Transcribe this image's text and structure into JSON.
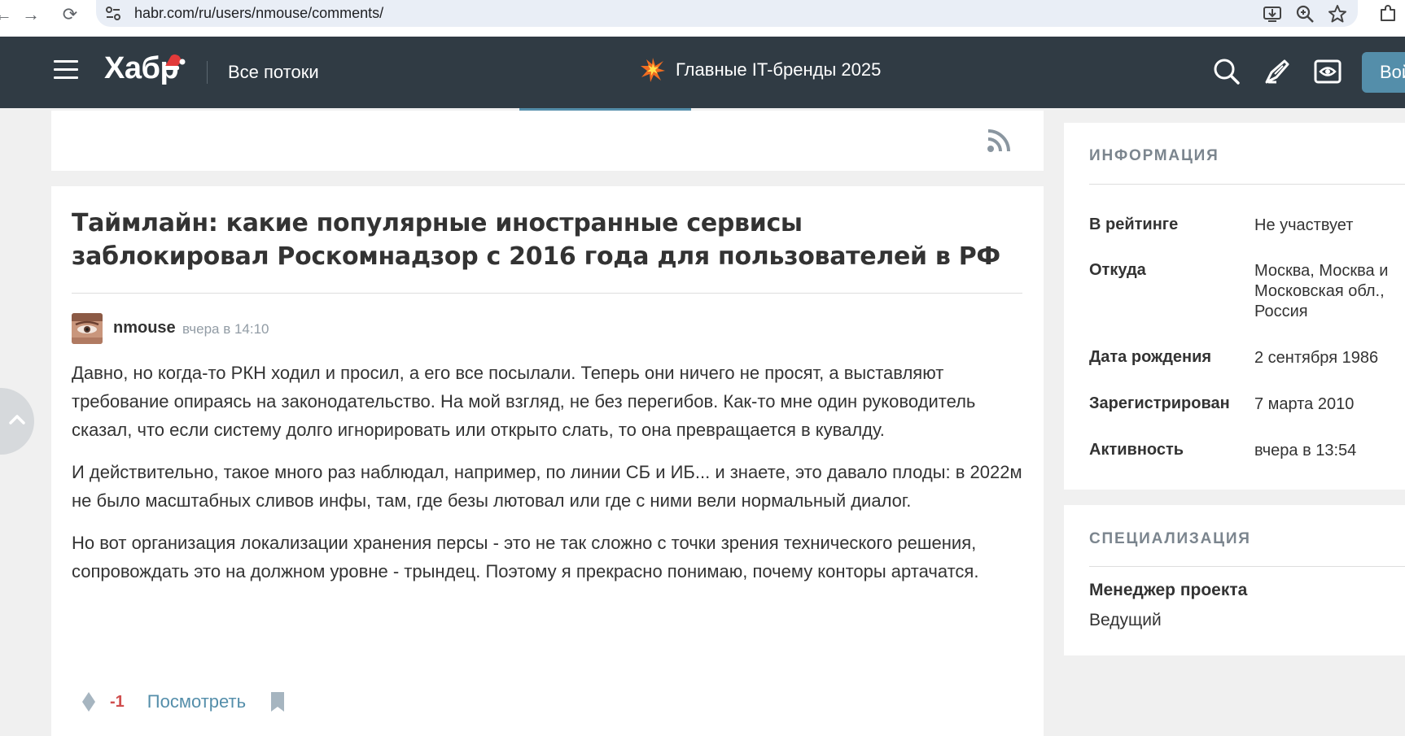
{
  "browser": {
    "back": "←",
    "forward": "→",
    "reload": "⟳",
    "url": "habr.com/ru/users/nmouse/comments/"
  },
  "header": {
    "logo": "Хабр",
    "all_flows": "Все потоки",
    "promo": "Главные IT-бренды 2025",
    "login": "Войти"
  },
  "comment": {
    "post_title": "Таймлайн: какие популярные иностранные сервисы заблокировал Роскомнадзор с 2016 года для пользователей в РФ",
    "author": "nmouse",
    "time": "вчера в 14:10",
    "paragraphs": [
      "Давно, но когда-то РКН ходил и просил, а его все посылали. Теперь они ничего не просят, а выставляют требование опираясь на законодательство. На мой взгляд, не без перегибов. Как-то мне один руководитель сказал, что если систему долго игнорировать или открыто слать, то она превращается в кувалду.",
      "И действительно, такое много раз наблюдал, например, по линии СБ и ИБ... и знаете, это давало плоды: в 2022м не было масштабных сливов инфы, там, где безы лютовал или где с ними вели нормальный диалог.",
      "Но вот организация локализации хранения персы - это не так сложно с точки зрения технического решения, сопровождать это на должном уровне - трындец. Поэтому я прекрасно понимаю, почему конторы артачатся."
    ],
    "score": "-1",
    "view_link": "Посмотреть"
  },
  "sidebar": {
    "info_heading": "ИНФОРМАЦИЯ",
    "info": [
      {
        "key": "В рейтинге",
        "value": "Не участвует"
      },
      {
        "key": "Откуда",
        "value": "Москва, Москва и Московская обл., Россия"
      },
      {
        "key": "Дата рождения",
        "value": "2 сентября 1986"
      },
      {
        "key": "Зарегистрирован",
        "value": "7 марта 2010"
      },
      {
        "key": "Активность",
        "value": "вчера в 13:54"
      }
    ],
    "spec_heading": "СПЕЦИАЛИЗАЦИЯ",
    "spec_title": "Менеджер проекта",
    "spec_level": "Ведущий"
  },
  "colors": {
    "header_bg": "#303b44",
    "accent": "#548eaa",
    "negative": "#d04e4e"
  }
}
